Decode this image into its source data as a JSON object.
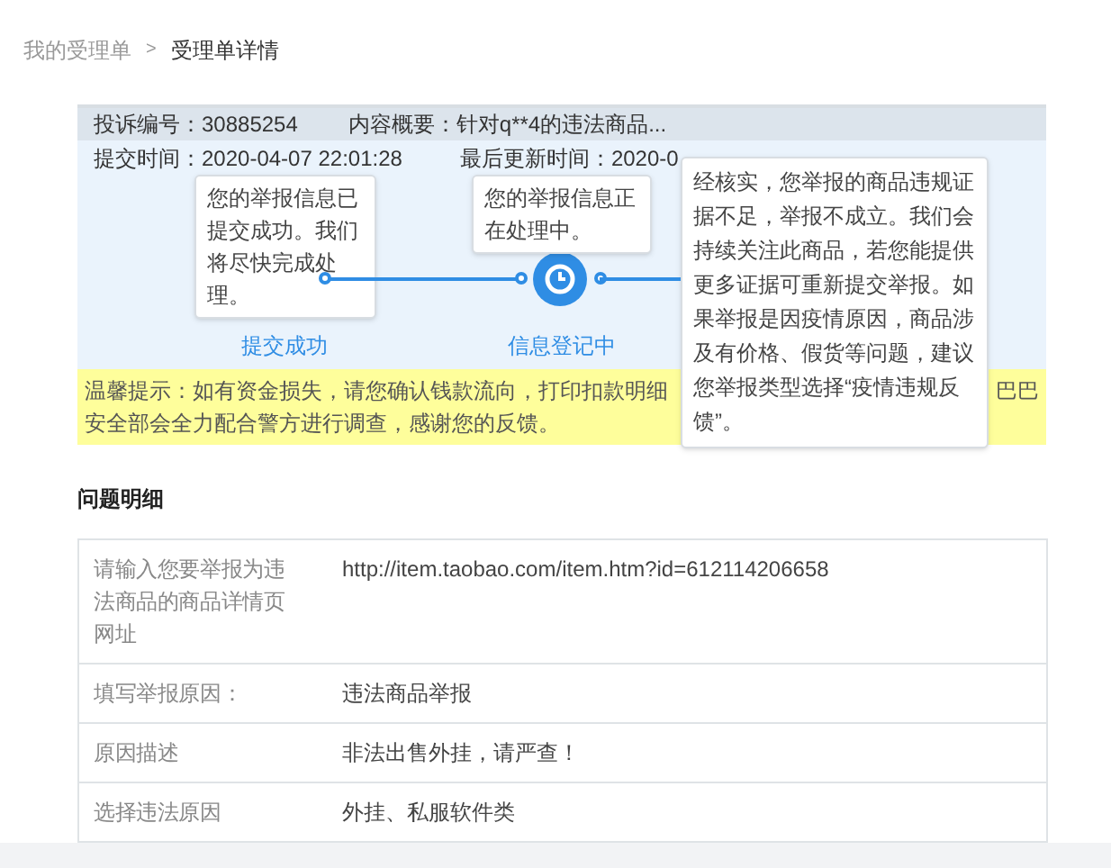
{
  "breadcrumb": [
    {
      "label": "我的受理单",
      "selected": false
    },
    {
      "label": "受理单详情",
      "selected": true
    }
  ],
  "breadcrumb_separator": ">",
  "summary": {
    "complaint_no": "投诉编号：30885254",
    "content": "内容概要：针对q**4的违法商品...",
    "submitted": "提交时间：2020-04-07 22:01:28",
    "updated": "最后更新时间：2020-0"
  },
  "steps": [
    {
      "label": "提交成功",
      "tooltip": "您的举报信息已提交成功。我们将尽快完成处理。",
      "current": false
    },
    {
      "label": "信息登记中",
      "tooltip": "您的举报信息正在处理中。",
      "current": true
    }
  ],
  "result_tooltip": "经核实，您举报的商品违规证据不足，举报不成立。我们会持续关注此商品，若您能提供更多证据可重新提交举报。如果举报是因疫情原因，商品涉及有价格、假货等问题，建议您举报类型选择“疫情违规反馈”。",
  "notice": {
    "line1_left": "温馨提示：如有资金损失，请您确认钱款流向，打印扣款明细",
    "line1_right": "巴巴",
    "line2": "安全部会全力配合警方进行调查，感谢您的反馈。"
  },
  "details": {
    "title": "问题明细",
    "rows": [
      {
        "label": "请输入您要举报为违法商品的商品详情页网址",
        "value": "http://item.taobao.com/item.htm?id=612114206658"
      },
      {
        "label": "填写举报原因：",
        "value": "违法商品举报"
      },
      {
        "label": "原因描述",
        "value": "非法出售外挂，请严查！"
      },
      {
        "label": "选择违法原因",
        "value": "外挂、私服软件类"
      }
    ]
  }
}
